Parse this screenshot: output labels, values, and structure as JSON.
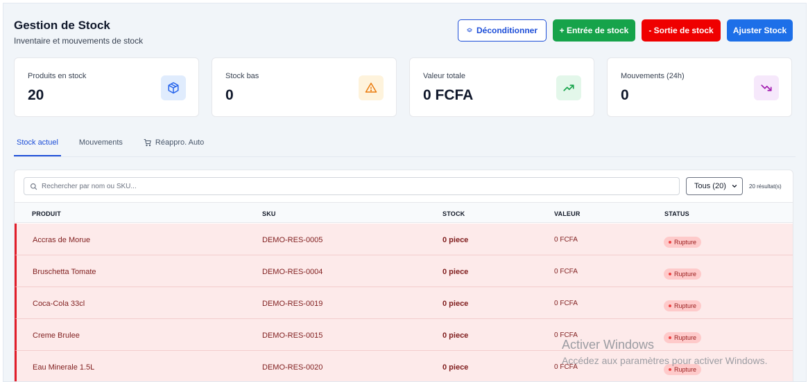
{
  "header": {
    "title": "Gestion de Stock",
    "subtitle": "Inventaire et mouvements de stock"
  },
  "actions": {
    "deconditionner": "Déconditionner",
    "entree": "+ Entrée de stock",
    "sortie": "- Sortie de stock",
    "ajuster": "Ajuster Stock"
  },
  "cards": [
    {
      "label": "Produits en stock",
      "value": "20",
      "icon": "package-icon",
      "color": "#2563eb",
      "bg": "#e0ecfd"
    },
    {
      "label": "Stock bas",
      "value": "0",
      "icon": "warning-icon",
      "color": "#ea7a0c",
      "bg": "#fef3dc"
    },
    {
      "label": "Valeur totale",
      "value": "0 FCFA",
      "icon": "trending-up-icon",
      "color": "#16a34a",
      "bg": "#e3f7ea"
    },
    {
      "label": "Mouvements (24h)",
      "value": "0",
      "icon": "trending-down-icon",
      "color": "#a21caf",
      "bg": "#f6e8fb"
    }
  ],
  "tabs": {
    "stock": "Stock actuel",
    "mouvements": "Mouvements",
    "reappro": "Réappro. Auto"
  },
  "toolbar": {
    "search_placeholder": "Rechercher par nom ou SKU...",
    "filter_value": "Tous (20)",
    "results": "20 résultat(s)"
  },
  "table": {
    "headers": {
      "produit": "PRODUIT",
      "sku": "SKU",
      "stock": "STOCK",
      "valeur": "VALEUR",
      "status": "STATUS"
    },
    "rows": [
      {
        "produit": "Accras de Morue",
        "sku": "DEMO-RES-0005",
        "stock": "0 piece",
        "valeur": "0 FCFA",
        "status": "Rupture"
      },
      {
        "produit": "Bruschetta Tomate",
        "sku": "DEMO-RES-0004",
        "stock": "0 piece",
        "valeur": "0 FCFA",
        "status": "Rupture"
      },
      {
        "produit": "Coca-Cola 33cl",
        "sku": "DEMO-RES-0019",
        "stock": "0 piece",
        "valeur": "0 FCFA",
        "status": "Rupture"
      },
      {
        "produit": "Creme Brulee",
        "sku": "DEMO-RES-0015",
        "stock": "0 piece",
        "valeur": "0 FCFA",
        "status": "Rupture"
      },
      {
        "produit": "Eau Minerale 1.5L",
        "sku": "DEMO-RES-0020",
        "stock": "0 piece",
        "valeur": "0 FCFA",
        "status": "Rupture"
      }
    ]
  },
  "watermark": {
    "title": "Activer Windows",
    "subtitle": "Accédez aux paramètres pour activer Windows."
  }
}
